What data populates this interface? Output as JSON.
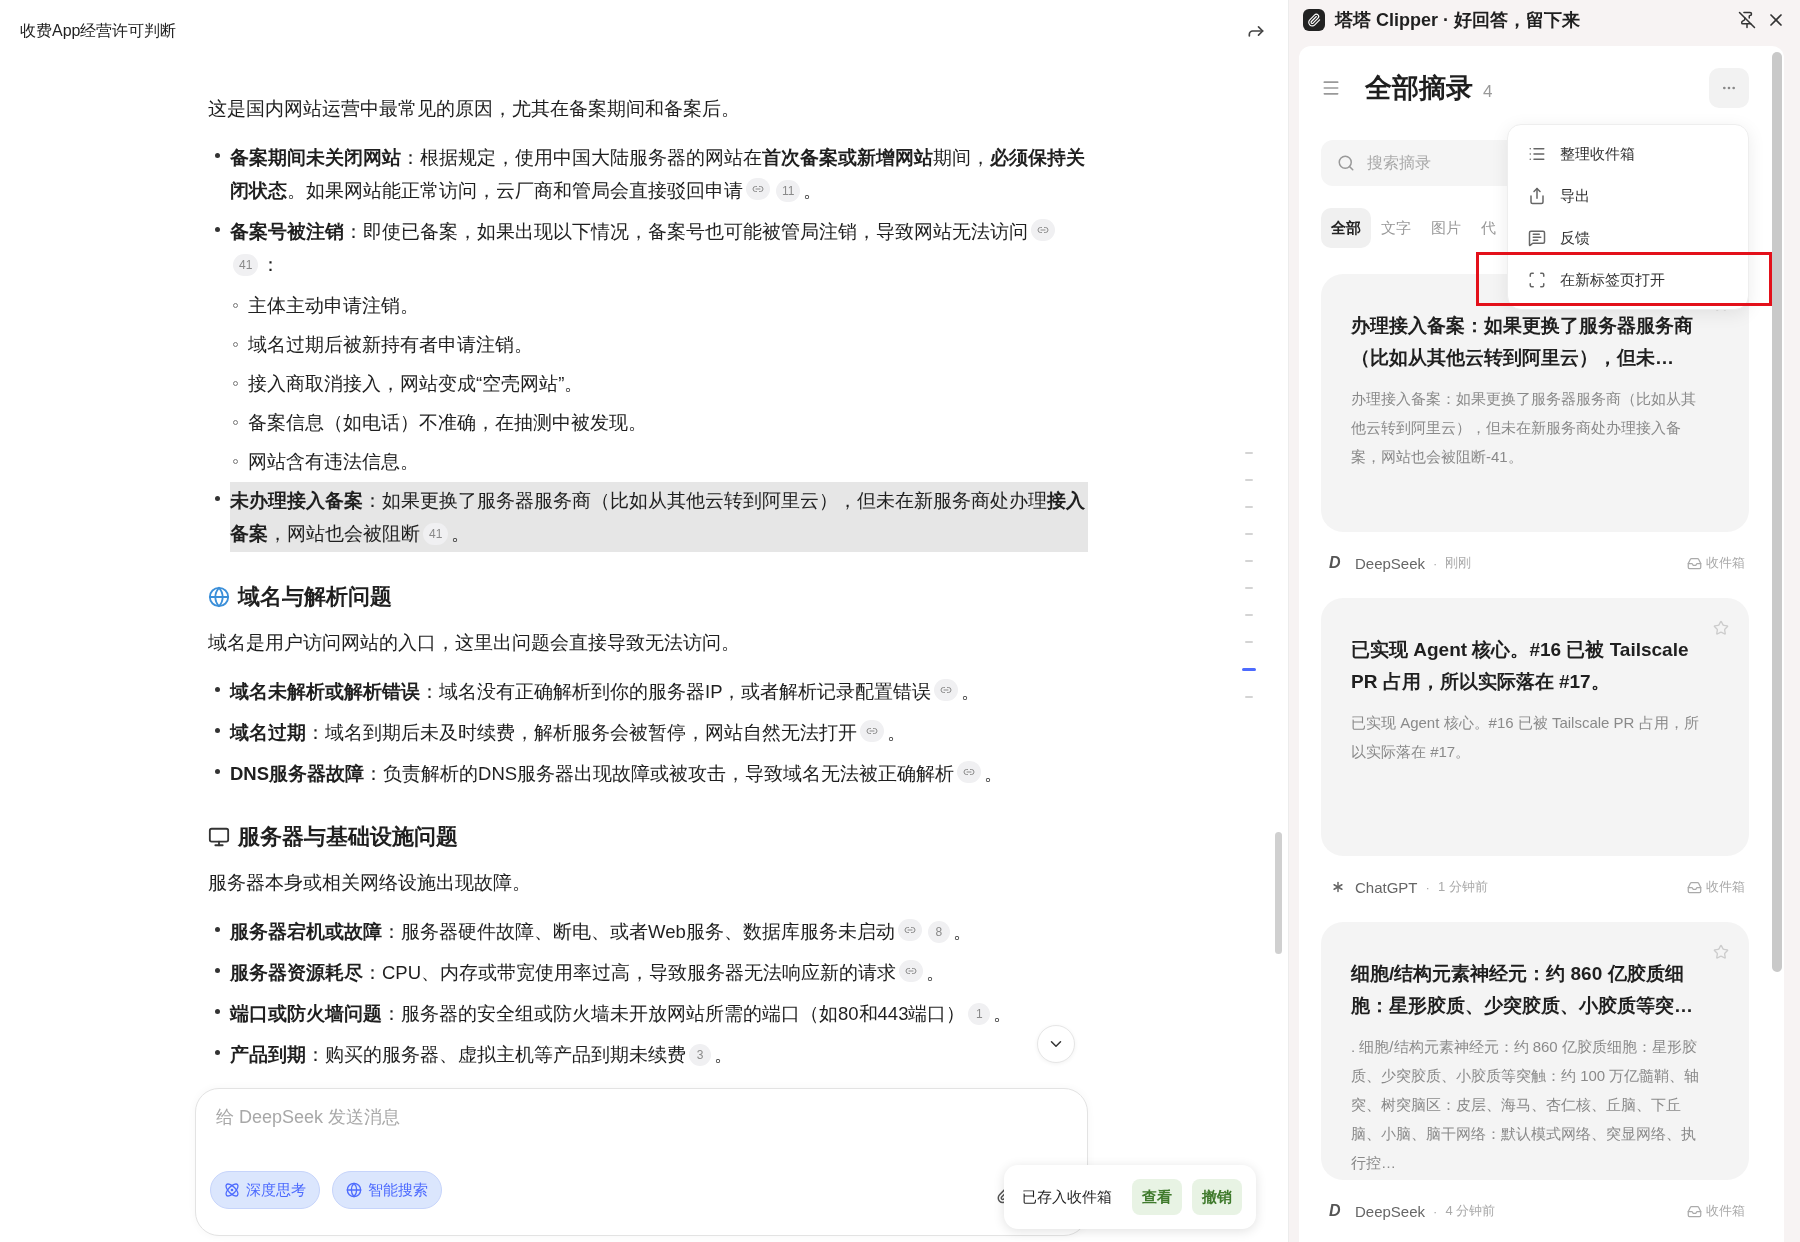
{
  "chat": {
    "title": "收费App经营许可判断",
    "sections": [
      {
        "intro": "这是国内网站运营中最常见的原因，尤其在备案期间和备案后。",
        "bullets": [
          {
            "text": "**备案期间未关闭网站**：根据规定，使用中国大陆服务器的网站在**首次备案或新增网站**期间，**必须保持关闭状态**。如果网站能正常访问，云厂商和管局会直接驳回申请",
            "citations": [
              {
                "kind": "link"
              },
              {
                "kind": "number",
                "label": "11"
              }
            ],
            "tail": "。",
            "highlighted": false
          },
          {
            "text": "**备案号被注销**：即使已备案，如果出现以下情况，备案号也可能被管局注销，导致网站无法访问",
            "citations": [
              {
                "kind": "link"
              },
              {
                "kind": "number",
                "label": "41"
              }
            ],
            "tail": "：",
            "highlighted": false,
            "children": [
              "主体主动申请注销。",
              "域名过期后被新持有者申请注销。",
              "接入商取消接入，网站变成“空壳网站”。",
              "备案信息（如电话）不准确，在抽测中被发现。",
              "网站含有违法信息。"
            ]
          },
          {
            "text": "**未办理接入备案**：如果更换了服务器服务商（比如从其他云转到阿里云），但未在新服务商处办理**接入备案**，网站也会被阻断",
            "citations": [
              {
                "kind": "number",
                "label": "41"
              }
            ],
            "tail": "。",
            "highlighted": true
          }
        ]
      },
      {
        "kind": "globe",
        "heading": "域名与解析问题",
        "intro": "域名是用户访问网站的入口，这里出问题会直接导致无法访问。",
        "bullets": [
          {
            "text": "**域名未解析或解析错误**：域名没有正确解析到你的服务器IP，或者解析记录配置错误",
            "citations": [
              {
                "kind": "link"
              }
            ],
            "tail": "。",
            "highlighted": false
          },
          {
            "text": "**域名过期**：域名到期后未及时续费，解析服务会被暂停，网站自然无法打开",
            "citations": [
              {
                "kind": "link"
              }
            ],
            "tail": "。",
            "highlighted": false
          },
          {
            "text": "**DNS服务器故障**：负责解析的DNS服务器出现故障或被攻击，导致域名无法被正确解析",
            "citations": [
              {
                "kind": "link"
              }
            ],
            "tail": "。",
            "highlighted": false
          }
        ]
      },
      {
        "kind": "monitor",
        "heading": "服务器与基础设施问题",
        "intro": "服务器本身或相关网络设施出现故障。",
        "bullets": [
          {
            "text": "**服务器宕机或故障**：服务器硬件故障、断电、或者Web服务、数据库服务未启动",
            "citations": [
              {
                "kind": "link"
              },
              {
                "kind": "number",
                "label": "8"
              }
            ],
            "tail": "。",
            "highlighted": false
          },
          {
            "text": "**服务器资源耗尽**：CPU、内存或带宽使用率过高，导致服务器无法响应新的请求",
            "citations": [
              {
                "kind": "link"
              }
            ],
            "tail": "。",
            "highlighted": false
          },
          {
            "text": "**端口或防火墙问题**：服务器的安全组或防火墙未开放网站所需的端口（如80和443端口）",
            "citations": [
              {
                "kind": "number",
                "label": "1"
              }
            ],
            "tail": "。",
            "highlighted": false
          },
          {
            "text": "**产品到期**：购买的服务器、虚拟主机等产品到期未续费",
            "citations": [
              {
                "kind": "number",
                "label": "3"
              }
            ],
            "tail": "。",
            "highlighted": false
          }
        ]
      }
    ],
    "outline_marks": [
      {
        "selected": false
      },
      {
        "selected": false
      },
      {
        "selected": false
      },
      {
        "selected": false
      },
      {
        "selected": false
      },
      {
        "selected": false
      },
      {
        "selected": false
      },
      {
        "selected": false
      },
      {
        "selected": true
      },
      {
        "selected": false
      }
    ],
    "composer": {
      "placeholder": "给 DeepSeek 发送消息",
      "toggles": [
        {
          "kind": "think",
          "label": "深度思考",
          "on": true
        },
        {
          "kind": "search",
          "label": "智能搜索",
          "on": true
        }
      ]
    },
    "toast": {
      "message": "已存入收件箱",
      "actions": [
        "查看",
        "撤销"
      ]
    }
  },
  "clipper": {
    "title": "塔塔 Clipper · 好回答，留下来",
    "heading": "全部摘录",
    "count": "4",
    "search": {
      "placeholder": "搜索摘录"
    },
    "filters": [
      {
        "label": "全部",
        "selected": true
      },
      {
        "label": "文字",
        "selected": false
      },
      {
        "label": "图片",
        "selected": false
      },
      {
        "label": "代",
        "selected": false
      }
    ],
    "menu": [
      {
        "kind": "organize",
        "label": "整理收件箱",
        "highlighted": false
      },
      {
        "kind": "export",
        "label": "导出",
        "highlighted": false
      },
      {
        "kind": "feedback",
        "label": "反馈",
        "highlighted": false
      },
      {
        "kind": "newtab",
        "label": "在新标签页打开",
        "highlighted": true
      }
    ],
    "cards": [
      {
        "title": "办理接入备案：如果更换了服务器服务商（比如从其他云转到阿里云），但未…",
        "body": "办理接入备案：如果更换了服务器服务商（比如从其他云转到阿里云），但未在新服务商处办理接入备案，网站也会被阻断-41。",
        "source": {
          "kind": "letter",
          "mark": "D",
          "name": "DeepSeek"
        },
        "separator": "·",
        "time": "刚刚",
        "folder": "收件箱"
      },
      {
        "title": "已实现 Agent 核心。#16 已被 Tailscale PR 占用，所以实际落在 #17。",
        "body": "已实现 Agent 核心。#16 已被 Tailscale PR 占用，所以实际落在 #17。",
        "source": {
          "kind": "asterisk",
          "name": "ChatGPT"
        },
        "separator": "·",
        "time": "1 分钟前",
        "folder": "收件箱"
      },
      {
        "title": "细胞/结构元素神经元：约 860 亿胶质细胞：星形胶质、少突胶质、小胶质等突…",
        "body": ". 细胞/结构元素神经元：约 860 亿胶质细胞：星形胶质、少突胶质、小胶质等突触：约 100 万亿髓鞘、轴突、树突脑区：皮层、海马、杏仁核、丘脑、下丘脑、小脑、脑干网络：默认模式网络、突显网络、执行控…",
        "source": {
          "kind": "letter",
          "mark": "D",
          "name": "DeepSeek"
        },
        "separator": "·",
        "time": "4 分钟前",
        "folder": "收件箱"
      }
    ]
  }
}
